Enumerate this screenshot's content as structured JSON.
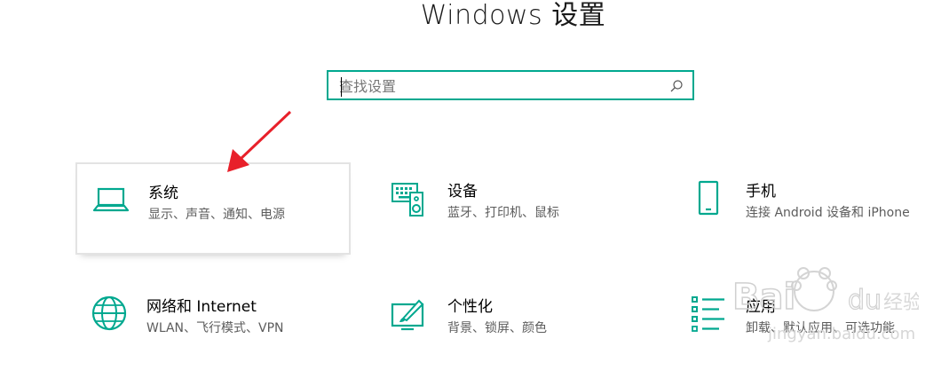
{
  "window": {
    "title": "Windows 设置"
  },
  "search": {
    "placeholder": "查找设置",
    "value": ""
  },
  "tiles": [
    {
      "id": "system",
      "name": "系统",
      "desc": "显示、声音、通知、电源",
      "icon": "laptop-icon",
      "selected": true
    },
    {
      "id": "devices",
      "name": "设备",
      "desc": "蓝牙、打印机、鼠标",
      "icon": "keyboard-speaker-icon",
      "selected": false
    },
    {
      "id": "phone",
      "name": "手机",
      "desc": "连接 Android 设备和 iPhone",
      "icon": "phone-icon",
      "selected": false
    },
    {
      "id": "network",
      "name": "网络和 Internet",
      "desc": "WLAN、飞行模式、VPN",
      "icon": "globe-icon",
      "selected": false
    },
    {
      "id": "personalization",
      "name": "个性化",
      "desc": "背景、锁屏、颜色",
      "icon": "paint-brush-icon",
      "selected": false
    },
    {
      "id": "apps",
      "name": "应用",
      "desc": "卸载、默认应用、可选功能",
      "icon": "apps-list-icon",
      "selected": false
    }
  ],
  "watermark": {
    "brand": "Bai du 经验",
    "url": "jingyan.baidu.com"
  },
  "colors": {
    "accent": "#00a88f",
    "annotation_arrow": "#e8202a"
  }
}
